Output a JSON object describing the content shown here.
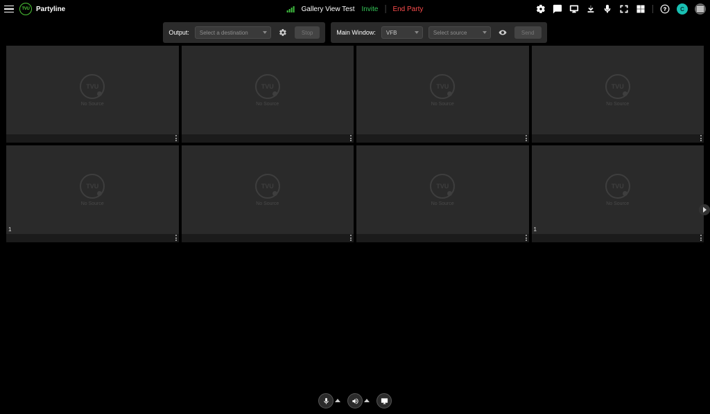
{
  "app_name": "Partyline",
  "session": {
    "name": "Gallery View Test",
    "invite_label": "Invite",
    "end_label": "End Party"
  },
  "output_panel": {
    "label": "Output:",
    "destination_placeholder": "Select a destination",
    "stop_label": "Stop"
  },
  "main_panel": {
    "label": "Main Window:",
    "window_value": "VFB",
    "source_placeholder": "Select source",
    "send_label": "Send"
  },
  "tiles": [
    {
      "placeholder": "No Source",
      "corner": ""
    },
    {
      "placeholder": "No Source",
      "corner": ""
    },
    {
      "placeholder": "No Source",
      "corner": ""
    },
    {
      "placeholder": "No Source",
      "corner": ""
    },
    {
      "placeholder": "No Source",
      "corner": "1"
    },
    {
      "placeholder": "No Source",
      "corner": ""
    },
    {
      "placeholder": "No Source",
      "corner": ""
    },
    {
      "placeholder": "No Source",
      "corner": "1"
    }
  ],
  "avatar_initial": "C"
}
